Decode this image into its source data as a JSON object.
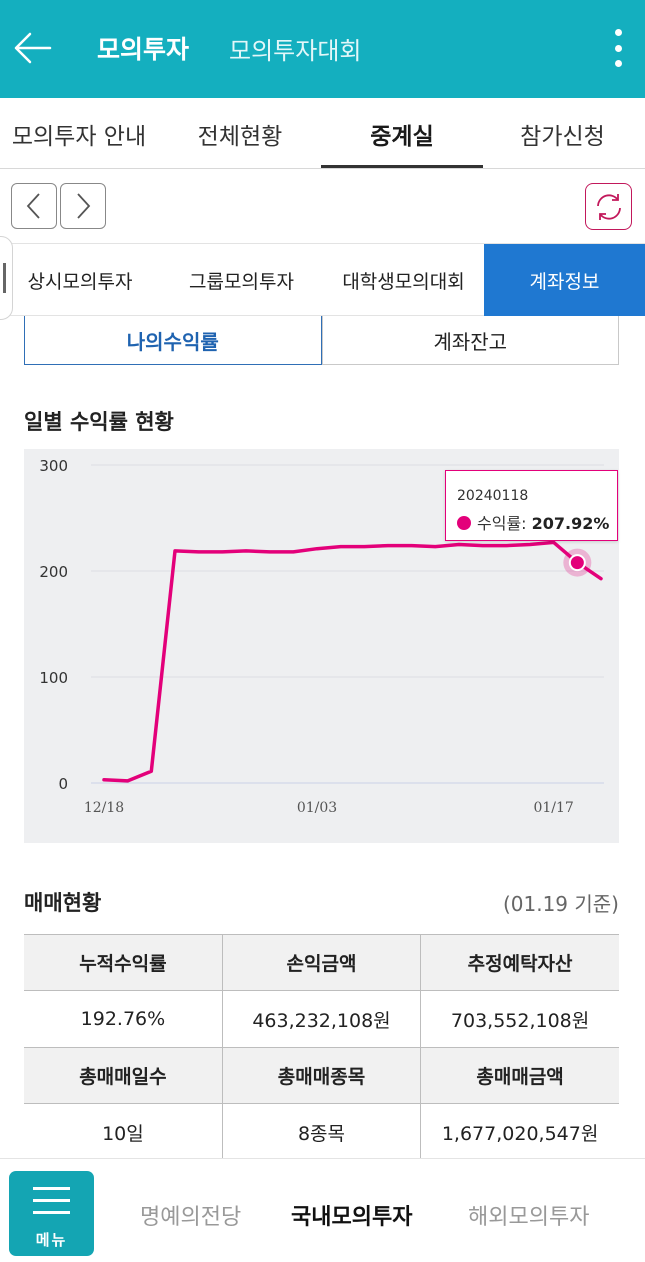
{
  "header": {
    "title": "모의투자",
    "subtitle": "모의투자대회",
    "back_icon": "arrow-left-icon",
    "menu_icon": "more-vertical-icon"
  },
  "main_tabs": [
    {
      "label": "모의투자 안내",
      "active": false
    },
    {
      "label": "전체현황",
      "active": false
    },
    {
      "label": "중계실",
      "active": true
    },
    {
      "label": "참가신청",
      "active": false
    }
  ],
  "nav": {
    "prev_icon": "chevron-left-icon",
    "next_icon": "chevron-right-icon",
    "refresh_icon": "refresh-icon"
  },
  "sub_tabs": [
    {
      "label": "상시모의투자",
      "active": false
    },
    {
      "label": "그룹모의투자",
      "active": false
    },
    {
      "label": "대학생모의대회",
      "active": false
    },
    {
      "label": "계좌정보",
      "active": true
    }
  ],
  "segment": [
    {
      "label": "나의수익률",
      "active": true
    },
    {
      "label": "계좌잔고",
      "active": false
    }
  ],
  "chart_section_title": "일별 수익률 현황",
  "chart_data": {
    "type": "line",
    "title": "",
    "xlabel": "",
    "ylabel": "",
    "ylim": [
      0,
      300
    ],
    "yticks": [
      "300",
      "200",
      "100",
      "0"
    ],
    "xtick_labels": [
      "12/18",
      "01/03",
      "01/17"
    ],
    "grid": true,
    "series": [
      {
        "name": "수익률",
        "color": "#e3007a",
        "x": [
          "12/18",
          "12/19",
          "12/20",
          "12/21",
          "12/22",
          "12/26",
          "12/27",
          "12/28",
          "01/02",
          "01/03",
          "01/04",
          "01/05",
          "01/08",
          "01/09",
          "01/10",
          "01/11",
          "01/12",
          "01/15",
          "01/16",
          "01/17",
          "01/18",
          "01/19"
        ],
        "values": [
          3,
          2,
          11,
          219,
          218,
          218,
          219,
          218,
          218,
          221,
          223,
          223,
          224,
          224,
          223,
          225,
          224,
          224,
          225,
          227,
          207.92,
          192.76
        ]
      }
    ],
    "tooltip": {
      "date": "20240118",
      "label": "수익률",
      "value": "207.92%"
    }
  },
  "trade_section_title": "매매현황",
  "trade_basis": "(01.19 기준)",
  "stats": {
    "row1_headers": [
      "누적수익률",
      "손익금액",
      "추정예탁자산"
    ],
    "row1_values": [
      "192.76%",
      "463,232,108원",
      "703,552,108원"
    ],
    "row2_headers": [
      "총매매일수",
      "총매매종목",
      "총매매금액"
    ],
    "row2_values": [
      "10일",
      "8종목",
      "1,677,020,547원"
    ]
  },
  "bottom_nav": {
    "menu_label": "메뉴",
    "items": [
      {
        "label": "명예의전당",
        "active": false
      },
      {
        "label": "국내모의투자",
        "active": true
      },
      {
        "label": "해외모의투자",
        "active": false
      }
    ]
  }
}
